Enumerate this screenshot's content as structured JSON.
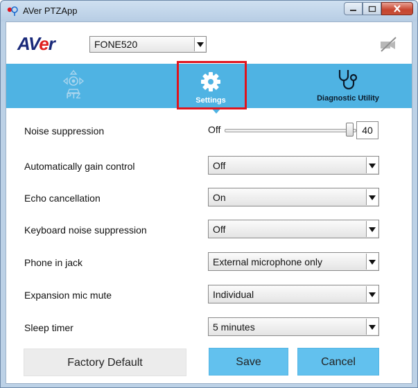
{
  "window": {
    "title": "AVer PTZApp"
  },
  "header": {
    "logo_text_pre": "AV",
    "logo_text_accent": "e",
    "logo_text_post": "r",
    "device": "FONE520"
  },
  "tabs": [
    {
      "label": "PTZ",
      "icon": "ptz-joystick-icon",
      "active": false
    },
    {
      "label": "Settings",
      "icon": "gear-icon",
      "active": true
    },
    {
      "label": "Diagnostic Utility",
      "icon": "stethoscope-icon",
      "active": false
    }
  ],
  "settings": {
    "noise_suppression": {
      "label": "Noise suppression",
      "min_label": "Off",
      "value": "40",
      "level_percent": 100
    },
    "agc": {
      "label": "Automatically gain control",
      "value": "Off"
    },
    "echo": {
      "label": "Echo cancellation",
      "value": "On"
    },
    "keyboard_noise": {
      "label": "Keyboard noise suppression",
      "value": "Off"
    },
    "phone_jack": {
      "label": "Phone in jack",
      "value": "External microphone only"
    },
    "expansion_mic": {
      "label": "Expansion mic mute",
      "value": "Individual"
    },
    "sleep_timer": {
      "label": "Sleep timer",
      "value": "5 minutes"
    }
  },
  "buttons": {
    "factory_default": "Factory Default",
    "save": "Save",
    "cancel": "Cancel"
  },
  "colors": {
    "tab_bar": "#4fb3e3",
    "primary_button": "#62c1ee",
    "highlight": "#e0141d"
  }
}
